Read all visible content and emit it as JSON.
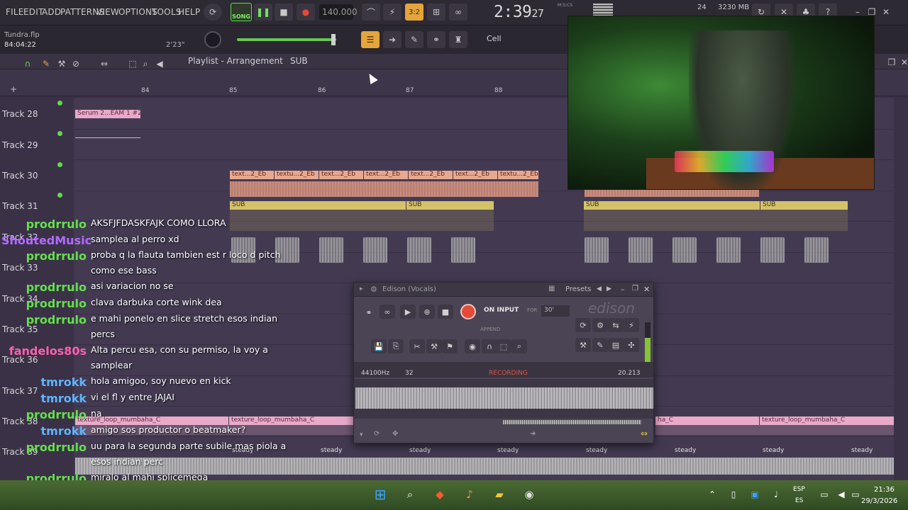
{
  "menu": [
    "FILE",
    "EDIT",
    "ADD",
    "PATTERNS",
    "VIEW",
    "OPTIONS",
    "TOOLS",
    "HELP"
  ],
  "transport": {
    "mode_label": "SONG",
    "tempo": "140.000",
    "time": "2:39",
    "time_sub": "27",
    "time_format": "M:S:CS",
    "pattern_indicator": "3:2"
  },
  "resources": {
    "cpu": "24",
    "ram": "3230 MB"
  },
  "project": {
    "filename": "Tundra.flp",
    "position": "84:04:22",
    "duration": "2'23\"",
    "snap": "Cell"
  },
  "playlist": {
    "title": "Playlist - Arrangement",
    "pattern": "SUB",
    "bars": [
      "84",
      "85",
      "86",
      "87",
      "88"
    ]
  },
  "tracks": [
    {
      "name": "Track 28"
    },
    {
      "name": "Track 29"
    },
    {
      "name": "Track 30"
    },
    {
      "name": "Track 31"
    },
    {
      "name": "Track 32"
    },
    {
      "name": "Track 33"
    },
    {
      "name": "Track 34"
    },
    {
      "name": "Track 35"
    },
    {
      "name": "Track 36"
    },
    {
      "name": "Track 37"
    },
    {
      "name": "Track 38"
    },
    {
      "name": "Track 39"
    }
  ],
  "clips": {
    "serum": "Serum 2...EAM 1 #2",
    "texture_short": [
      "text...2_Eb",
      "textu...2_Eb",
      "text...2_Eb",
      "text...2_Eb",
      "text...2_Eb",
      "text...2_Eb",
      "textu...2_Eb"
    ],
    "sub": "SUB",
    "texture_loop": "texture_loop_mumbaha_C",
    "texture_loop_right": "texture_loop_mumbaha_C",
    "texture_loop_cut": "ha_C",
    "steady": "steady"
  },
  "chat": [
    {
      "user": "prodrrulo",
      "color": "#63e04a",
      "msg": "AKSFJFDASKFAJK COMO LLORA"
    },
    {
      "user": "ShoutedMusic",
      "color": "#b26bff",
      "msg": "samplea al perro xd"
    },
    {
      "user": "prodrrulo",
      "color": "#63e04a",
      "msg": "proba q la flauta tambien est r loco d pitch"
    },
    {
      "user": "",
      "color": "#63e04a",
      "msg": "como ese bass"
    },
    {
      "user": "prodrrulo",
      "color": "#63e04a",
      "msg": "asi variacion no se"
    },
    {
      "user": "prodrrulo",
      "color": "#63e04a",
      "msg": "clava darbuka corte wink dea"
    },
    {
      "user": "prodrrulo",
      "color": "#63e04a",
      "msg": "e mahi ponelo en slice stretch esos indian"
    },
    {
      "user": "",
      "color": "#63e04a",
      "msg": "percs"
    },
    {
      "user": "fandelos80s",
      "color": "#ff5fb0",
      "msg": "Alta percu esa, con su permiso, la voy a"
    },
    {
      "user": "",
      "color": "#ff5fb0",
      "msg": "samplear"
    },
    {
      "user": "tmrokk",
      "color": "#5fb4ff",
      "msg": "hola amigoo, soy nuevo en kick"
    },
    {
      "user": "tmrokk",
      "color": "#5fb4ff",
      "msg": "vi el fl y entre JAJAI"
    },
    {
      "user": "prodrrulo",
      "color": "#63e04a",
      "msg": "na"
    },
    {
      "user": "tmrokk",
      "color": "#5fb4ff",
      "msg": "amigo sos productor o beatmaker?"
    },
    {
      "user": "prodrrulo",
      "color": "#63e04a",
      "msg": "uu para la segunda parte subile mas piola a"
    },
    {
      "user": "",
      "color": "#63e04a",
      "msg": "esos indian perc"
    },
    {
      "user": "prodrrulo",
      "color": "#63e04a",
      "msg": "miralo al mahi splicemega"
    }
  ],
  "edison": {
    "title": "Edison (Vocals)",
    "presets": "Presets",
    "on_input": "ON INPUT",
    "for_label": "FOR",
    "seconds": "30'",
    "append": "APPEND",
    "logo": "edison",
    "sample_rate": "44100Hz",
    "bits": "32",
    "status": "RECORDING",
    "length": "20.213"
  },
  "taskbar": {
    "lang1": "ESP",
    "lang2": "ES",
    "time": "21:36",
    "date": "29/3/2026"
  },
  "colors": {
    "accent_green": "#63d94d",
    "playlist_bg": "#433a52",
    "record_red": "#e54a37"
  }
}
